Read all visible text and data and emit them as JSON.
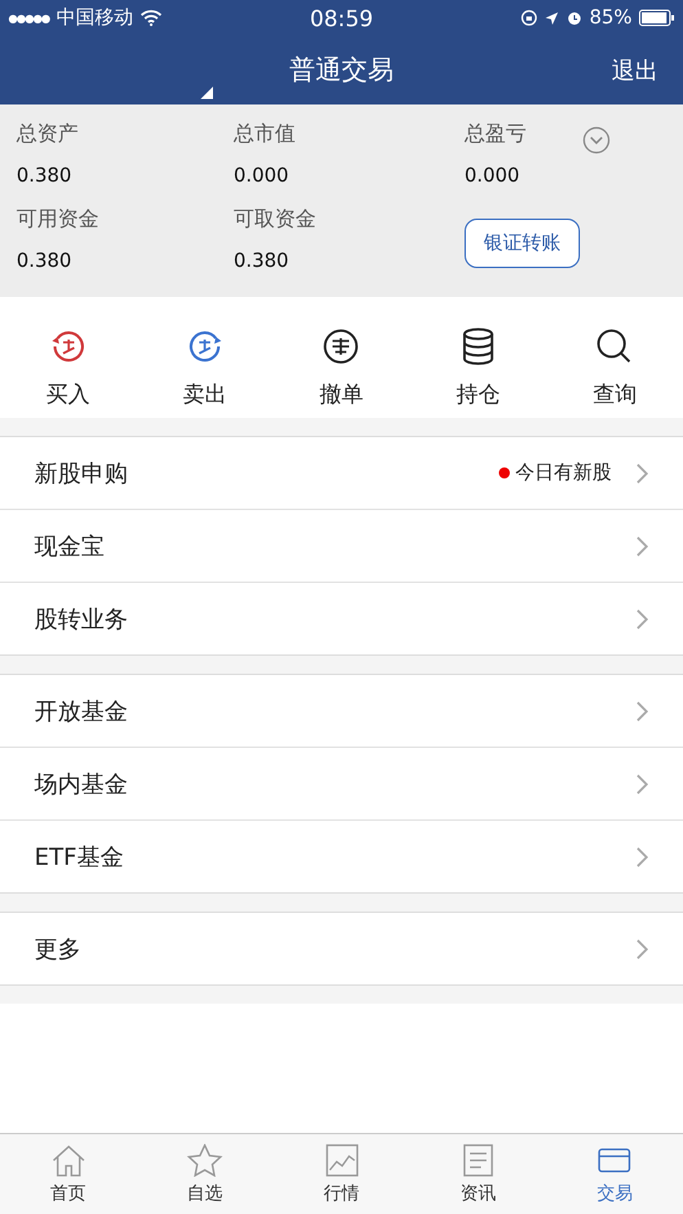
{
  "status_bar": {
    "signal": "●●●●●",
    "carrier": "中国移动",
    "time": "08:59",
    "battery": "85%"
  },
  "nav": {
    "title": "普通交易",
    "action": "退出"
  },
  "summary": {
    "fields": [
      {
        "label": "总资产",
        "value": "0.380"
      },
      {
        "label": "总市值",
        "value": "0.000"
      },
      {
        "label": "总盈亏",
        "value": "0.000"
      },
      {
        "label": "可用资金",
        "value": "0.380"
      },
      {
        "label": "可取资金",
        "value": "0.380"
      }
    ],
    "expanded": false,
    "button": "银证转账"
  },
  "actions": [
    {
      "kind": "buy",
      "label": "买入"
    },
    {
      "kind": "sell",
      "label": "卖出"
    },
    {
      "kind": "cancel",
      "label": "撤单"
    },
    {
      "kind": "holdings",
      "label": "持仓"
    },
    {
      "kind": "search",
      "label": "查询"
    }
  ],
  "menu_groups": [
    [
      {
        "label": "新股申购",
        "badge": "今日有新股"
      },
      {
        "label": "现金宝"
      },
      {
        "label": "股转业务"
      }
    ],
    [
      {
        "label": "开放基金"
      },
      {
        "label": "场内基金"
      },
      {
        "label": "ETF基金"
      }
    ],
    [
      {
        "label": "更多"
      }
    ]
  ],
  "tab_bar": [
    {
      "kind": "home",
      "label": "首页",
      "selected": false
    },
    {
      "kind": "star",
      "label": "自选",
      "selected": false
    },
    {
      "kind": "chart",
      "label": "行情",
      "selected": false
    },
    {
      "kind": "news",
      "label": "资讯",
      "selected": false
    },
    {
      "kind": "trade",
      "label": "交易",
      "selected": true
    }
  ]
}
